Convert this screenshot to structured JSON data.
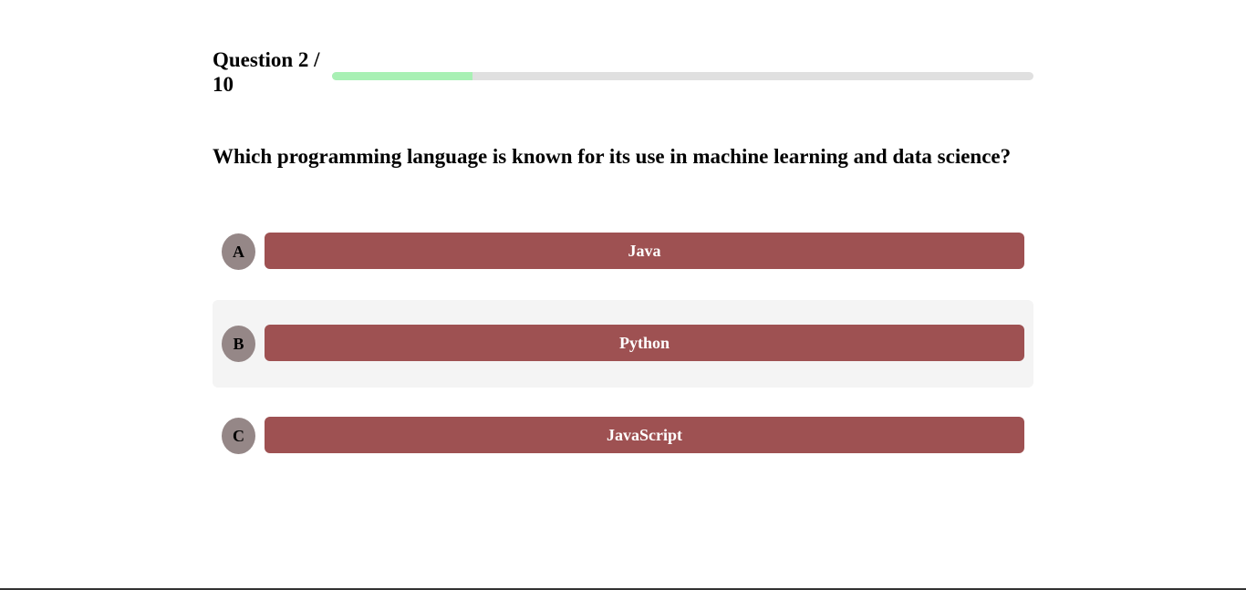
{
  "header": {
    "question_counter": "Question 2 / 10",
    "progress_fraction": 0.2,
    "progress_color": "#a8f0b4",
    "track_color": "#e0e0e0"
  },
  "question": {
    "text": "Which programming language is known for its use in machine learning and data science?"
  },
  "answers": [
    {
      "letter": "A",
      "label": "Java"
    },
    {
      "letter": "B",
      "label": "Python"
    },
    {
      "letter": "C",
      "label": "JavaScript"
    }
  ],
  "colors": {
    "answer_button": "#9e5152",
    "letter_badge": "#958787",
    "highlight_row": "#f4f4f4"
  }
}
